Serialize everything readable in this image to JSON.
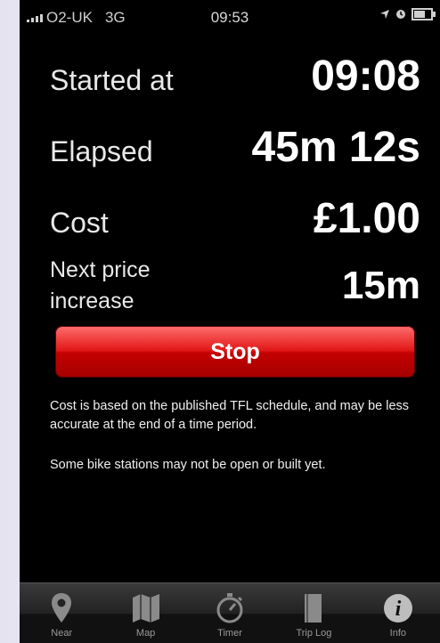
{
  "statusbar": {
    "carrier": "O2-UK",
    "network": "3G",
    "time": "09:53"
  },
  "rows": {
    "started_label": "Started at",
    "started_value": "09:08",
    "elapsed_label": "Elapsed",
    "elapsed_value": "45m 12s",
    "cost_label": "Cost",
    "cost_value": "£1.00",
    "next_price_label_line1": "Next price",
    "next_price_label_line2": "increase",
    "next_price_value": "15m"
  },
  "stop_button_label": "Stop",
  "notes": {
    "schedule": "Cost is based on the published TFL schedule, and may be less accurate at the end of a time period.",
    "stations": "Some bike stations may not be open or built yet."
  },
  "tabs": [
    {
      "label": "Near",
      "icon": "map-pin-icon"
    },
    {
      "label": "Map",
      "icon": "map-icon"
    },
    {
      "label": "Timer",
      "icon": "stopwatch-icon"
    },
    {
      "label": "Trip Log",
      "icon": "book-icon"
    },
    {
      "label": "Info",
      "icon": "info-icon"
    }
  ],
  "colors": {
    "background": "#000000",
    "stop_button": "#e21616",
    "tabbar": "#222222"
  }
}
